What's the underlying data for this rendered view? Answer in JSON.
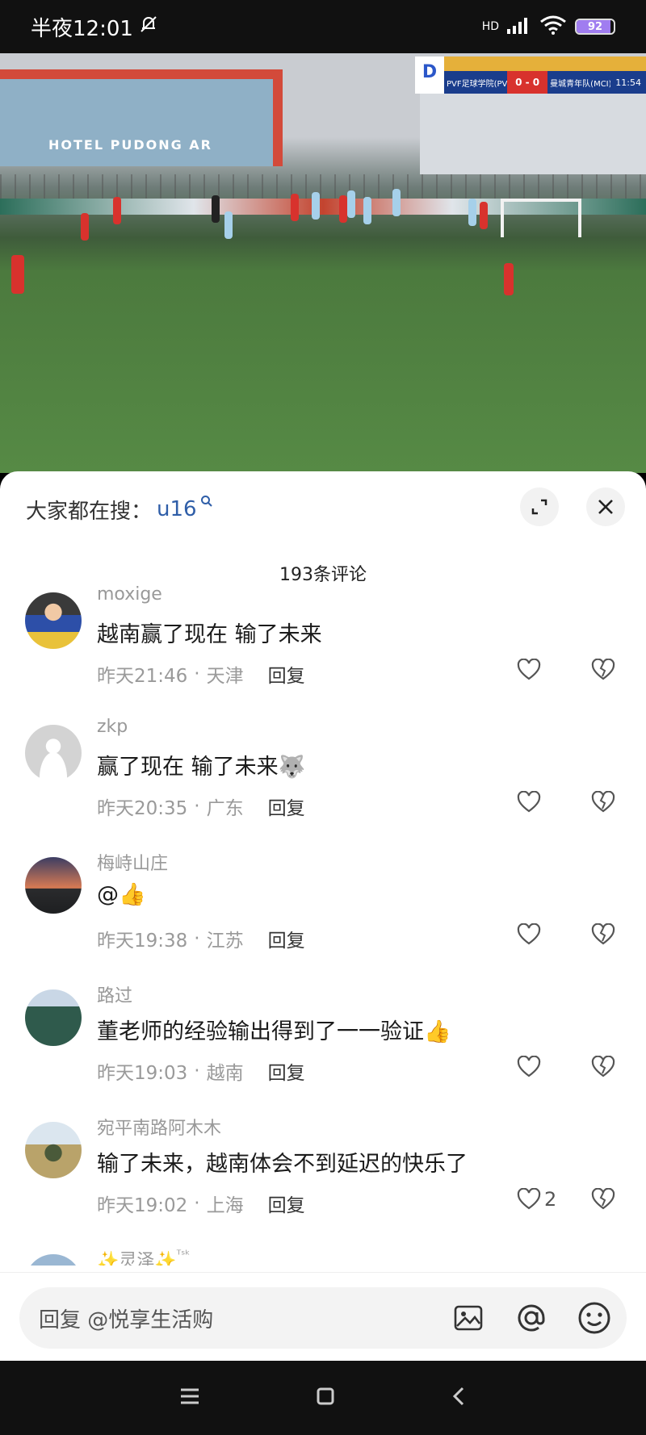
{
  "status_bar": {
    "time": "半夜12:01",
    "network": "HD",
    "wifi_label": "6",
    "battery": "92",
    "battery_level": 0.92
  },
  "video": {
    "stadium_banner": "HOTEL PUDONG AR",
    "scoreboard": {
      "home_team": "PVF足球学院(PVF)",
      "score": "0 - 0",
      "away_team": "曼城青年队(MCI)",
      "clock": "11:54"
    }
  },
  "sheet": {
    "search_prefix": "大家都在搜：",
    "search_term": "u16",
    "comment_count": "193条评论"
  },
  "comments": [
    {
      "name": "moxige",
      "text": "越南赢了现在 输了未来",
      "time": "昨天21:46",
      "location": "天津",
      "reply": "回复",
      "likes": ""
    },
    {
      "name": "zkp",
      "text": "赢了现在 输了未来",
      "emoji": "🐺",
      "time": "昨天20:35",
      "location": "广东",
      "reply": "回复",
      "likes": ""
    },
    {
      "name": "梅峙山庄",
      "text": "@",
      "emoji": "👍",
      "time": "昨天19:38",
      "location": "江苏",
      "reply": "回复",
      "likes": ""
    },
    {
      "name": "路过",
      "text": "董老师的经验输出得到了一一验证",
      "emoji": "👍",
      "time": "昨天19:03",
      "location": "越南",
      "reply": "回复",
      "likes": ""
    },
    {
      "name": "宛平南路阿木木",
      "text": "输了未来，越南体会不到延迟的快乐了",
      "time": "昨天19:02",
      "location": "上海",
      "reply": "回复",
      "likes": "2"
    },
    {
      "name": "✨灵泽✨",
      "badge": "ᵀˢᵏ"
    }
  ],
  "input": {
    "placeholder": "回复 @悦享生活购"
  },
  "colors": {
    "accent_blue": "#2f5ea8",
    "meta_gray": "#9a9a9a",
    "battery_purple": "#a07df0"
  }
}
